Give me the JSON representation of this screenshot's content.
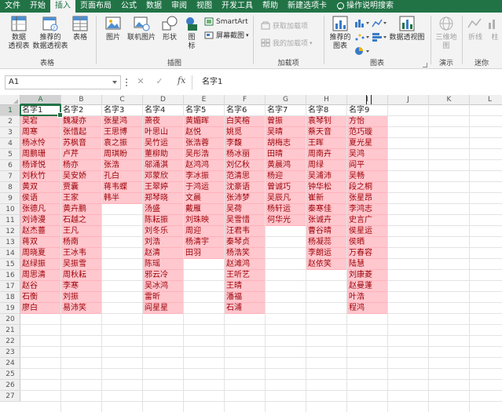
{
  "ribbon_tabs": [
    "文件",
    "开始",
    "插入",
    "页面布局",
    "公式",
    "数据",
    "审阅",
    "视图",
    "开发工具",
    "帮助",
    "新建选项卡",
    "操作说明搜索"
  ],
  "active_tab": "插入",
  "groups": {
    "tables": {
      "label": "表格",
      "pivot": "数据\n透视表",
      "recommended_pivot": "推荐的\n数据透视表",
      "table": "表格"
    },
    "illustrations": {
      "label": "插图",
      "picture": "图片",
      "online_picture": "联机图片",
      "shapes": "形状",
      "icons": "图\n标",
      "smartart": "SmartArt",
      "screenshot": "屏幕截图"
    },
    "addins": {
      "label": "加载项",
      "get_addins": "获取加载项",
      "my_addins": "我的加载项"
    },
    "charts": {
      "label": "图表",
      "recommended_charts": "推荐的\n图表",
      "pivot_chart": "数据透视图"
    },
    "tours": {
      "label": "演示",
      "map3d": "三维地\n图"
    },
    "sparklines": {
      "label": "迷你",
      "line": "折线",
      "column": "柱"
    }
  },
  "formula_bar": {
    "name_box": "A1",
    "cancel": "✕",
    "enter": "✓",
    "fx": "fx",
    "content": "名字1"
  },
  "accent_color": "#217346",
  "highlight_fill": "#ffc7ce",
  "highlight_text": "#9c0006",
  "columns": [
    "A",
    "B",
    "C",
    "D",
    "E",
    "F",
    "G",
    "H",
    "I",
    "J",
    "K",
    "L"
  ],
  "rows": [
    "1",
    "2",
    "3",
    "4",
    "5",
    "6",
    "7",
    "8",
    "9",
    "10",
    "11",
    "12",
    "13",
    "14",
    "15",
    "16",
    "17",
    "18",
    "19",
    "20",
    "21",
    "22",
    "23",
    "24",
    "25",
    "26",
    "27"
  ],
  "sheet": {
    "A": [
      "名字1",
      "吴宕",
      "周寒",
      "杨冰怜",
      "周鹏珊",
      "杨译悦",
      "刘秋竹",
      "黄双",
      "侯语",
      "张德凡",
      "刘诗漫",
      "赵杰薔",
      "蒋双",
      "周晓夏",
      "赵绿振",
      "周思清",
      "赵谷",
      "石衡",
      "廖白"
    ],
    "B": [
      "名字2",
      "魏凝亦",
      "张惜起",
      "苏枫音",
      "卢芹",
      "杨亦",
      "吴安娇",
      "贾囊",
      "王家",
      "黄卉鹏",
      "石越之",
      "王凡",
      "杨南",
      "王冰韦",
      "吴振雪",
      "周秋耘",
      "李寒",
      "刘振",
      "易沛笑"
    ],
    "C": [
      "名字3",
      "张星鸿",
      "王思博",
      "袁之振",
      "周琪盼",
      "张浩",
      "孔白",
      "蒋韦蝶",
      "韩半"
    ],
    "D": [
      "名字4",
      "萧夜",
      "叶思山",
      "吴竹运",
      "董柳助",
      "邬涌淇",
      "邓蒙欣",
      "王翠婷",
      "郑琴晓",
      "汤盛",
      "陈耘振",
      "刘冬乐",
      "刘浩",
      "赵清",
      "陈瑶",
      "邪云冷",
      "吴冰鸿",
      "雷昕",
      "阎星星"
    ],
    "E": [
      "名字5",
      "黄媚晖",
      "赵悦",
      "张浩蓉",
      "吴彤浩",
      "赵鸿鸿",
      "李冰振",
      "于鸿运",
      "文晨",
      "戴雁",
      "刘珠映",
      "周迎",
      "杨清宇",
      "田羽"
    ],
    "F": [
      "名字6",
      "白笑榕",
      "姚觅",
      "李馥",
      "杨冰丽",
      "刘亿秋",
      "范清思",
      "沈豪语",
      "张沛梦",
      "吴荷",
      "吴雪惜",
      "汪君韦",
      "秦琴贞",
      "杨浩笑",
      "赵滩鸿",
      "王听艺",
      "王晴",
      "潘福",
      "石浦"
    ],
    "G": [
      "名字7",
      "曾振",
      "吴晴",
      "胡梅志",
      "田晴",
      "黄晨鸿",
      "杨迎",
      "曾诚巧",
      "吴辰凡",
      "杨轩运",
      "何华光"
    ],
    "H": [
      "名字8",
      "袁琴钊",
      "蔡天音",
      "王晖",
      "周南卉",
      "周绿",
      "吴浦沛",
      "钟华松",
      "崔新",
      "秦寒佳",
      "张诚卉",
      "曹谷晴",
      "杨凝蕊",
      "李朗运",
      "赵依笑"
    ],
    "I": [
      "名字9",
      "方怡",
      "范巧璇",
      "夏光星",
      "吴鸿",
      "阎平",
      "吴畅",
      "段之桐",
      "张星昂",
      "李鸿志",
      "史言广",
      "侯星运",
      "侯晒",
      "万春容",
      "陆慧",
      "刘康菱",
      "赵曼蓬",
      "叶浩",
      "程鸿"
    ]
  }
}
